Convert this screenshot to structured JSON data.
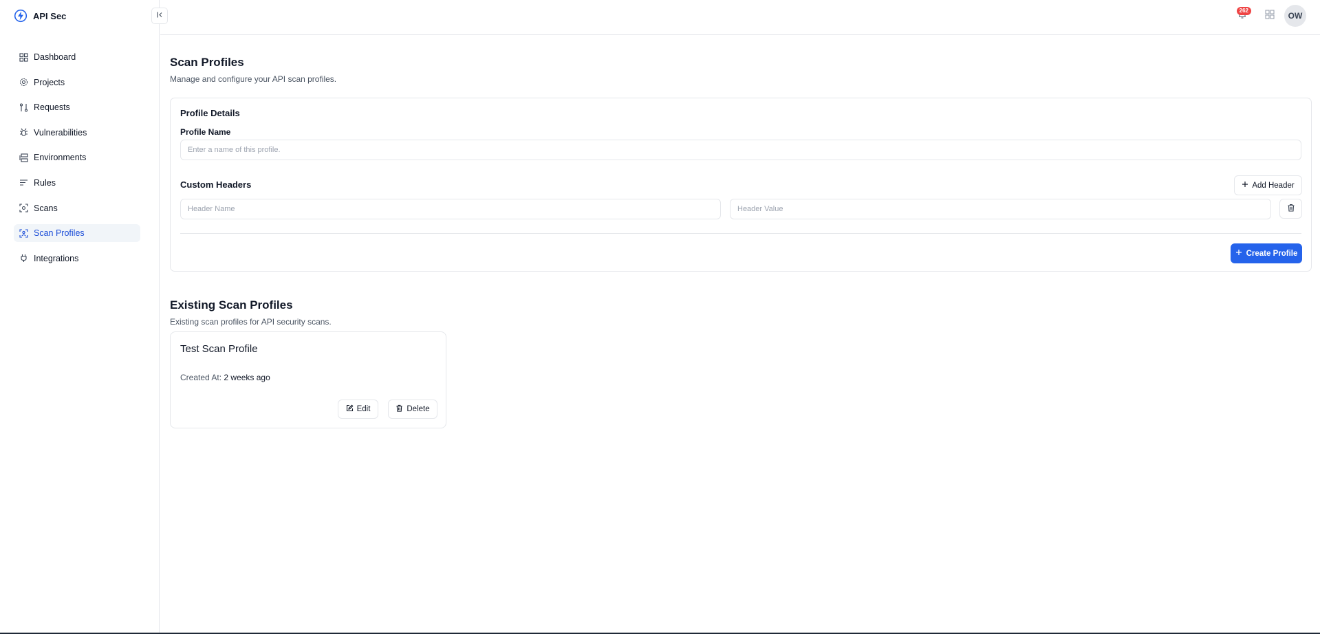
{
  "brand": {
    "name": "API Sec"
  },
  "sidebar": {
    "items": [
      {
        "label": "Dashboard",
        "icon": "grid-icon"
      },
      {
        "label": "Projects",
        "icon": "gear-icon"
      },
      {
        "label": "Requests",
        "icon": "route-icon"
      },
      {
        "label": "Vulnerabilities",
        "icon": "bug-icon"
      },
      {
        "label": "Environments",
        "icon": "layers-icon"
      },
      {
        "label": "Rules",
        "icon": "list-icon"
      },
      {
        "label": "Scans",
        "icon": "scan-icon"
      },
      {
        "label": "Scan Profiles",
        "icon": "scan-profile-icon",
        "active": true
      },
      {
        "label": "Integrations",
        "icon": "plug-icon"
      }
    ]
  },
  "header": {
    "notification_count": "262",
    "avatar_initials": "OW"
  },
  "page": {
    "title": "Scan Profiles",
    "subtitle": "Manage and configure your API scan profiles."
  },
  "form": {
    "card_title": "Profile Details",
    "profile_name_label": "Profile Name",
    "profile_name_placeholder": "Enter a name of this profile.",
    "profile_name_value": "",
    "custom_headers_title": "Custom Headers",
    "add_header_label": "Add Header",
    "header_name_placeholder": "Header Name",
    "header_value_placeholder": "Header Value",
    "create_label": "Create Profile"
  },
  "existing": {
    "title": "Existing Scan Profiles",
    "subtitle": "Existing scan profiles for API security scans.",
    "profiles": [
      {
        "name": "Test Scan Profile",
        "created_label": "Created At:",
        "created_value": "2 weeks ago",
        "edit_label": "Edit",
        "delete_label": "Delete"
      }
    ]
  },
  "colors": {
    "accent": "#2563eb",
    "active_nav_bg": "#f1f5f9",
    "badge": "#ef4444",
    "border": "#e5e7eb"
  }
}
